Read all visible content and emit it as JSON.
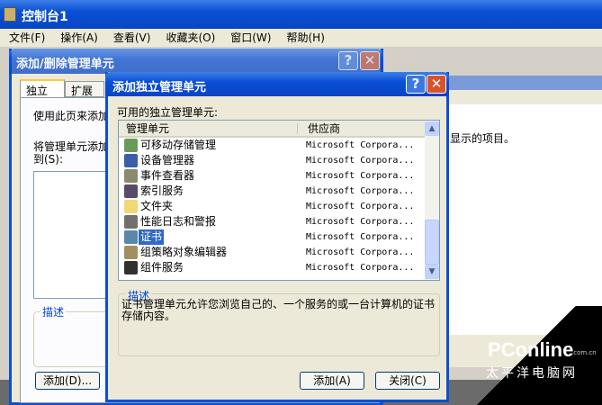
{
  "main_window": {
    "title": "控制台1",
    "menu": [
      "文件(F)",
      "操作(A)",
      "查看(V)",
      "收藏夹(O)",
      "窗口(W)",
      "帮助(H)"
    ]
  },
  "back_dialog": {
    "title": "添加/删除管理单元",
    "tabs": [
      "独立",
      "扩展"
    ],
    "intro_text": "使用此页来添加",
    "right_text": "显示的项目。",
    "add_to_label": "将管理单元添加到(S):",
    "description_label": "描述",
    "add_button": "添加(D)..."
  },
  "front_dialog": {
    "title": "添加独立管理单元",
    "help": "?",
    "close": "✕",
    "list_label": "可用的独立管理单元:",
    "columns": [
      "管理单元",
      "供应商"
    ],
    "rows": [
      {
        "name": "可移动存储管理",
        "vendor": "Microsoft Corpora...",
        "icon": "removable-storage-icon",
        "color": "#6a9a5a"
      },
      {
        "name": "设备管理器",
        "vendor": "Microsoft Corpora...",
        "icon": "device-manager-icon",
        "color": "#3a5ea8"
      },
      {
        "name": "事件查看器",
        "vendor": "Microsoft Corpora...",
        "icon": "event-viewer-icon",
        "color": "#8a8a70"
      },
      {
        "name": "索引服务",
        "vendor": "Microsoft Corpora...",
        "icon": "indexing-service-icon",
        "color": "#5a4a6a"
      },
      {
        "name": "文件夹",
        "vendor": "Microsoft Corpora...",
        "icon": "folder-icon",
        "color": "#f0d878"
      },
      {
        "name": "性能日志和警报",
        "vendor": "Microsoft Corpora...",
        "icon": "performance-icon",
        "color": "#707070"
      },
      {
        "name": "证书",
        "vendor": "Microsoft Corpora...",
        "icon": "certificate-icon",
        "color": "#5a88a8",
        "selected": true
      },
      {
        "name": "组策略对象编辑器",
        "vendor": "Microsoft Corpora...",
        "icon": "group-policy-icon",
        "color": "#a09060"
      },
      {
        "name": "组件服务",
        "vendor": "Microsoft Corpora...",
        "icon": "component-services-icon",
        "color": "#303030"
      }
    ],
    "description_label": "描述",
    "description": "证书管理单元允许您浏览自己的、一个服务的或一台计算机的证书存储内容。",
    "add_button": "添加(A)",
    "close_button": "关闭(C)"
  },
  "watermark": {
    "brand": "PConline",
    "domain": ".com.cn",
    "cn": "太平洋电脑网"
  }
}
